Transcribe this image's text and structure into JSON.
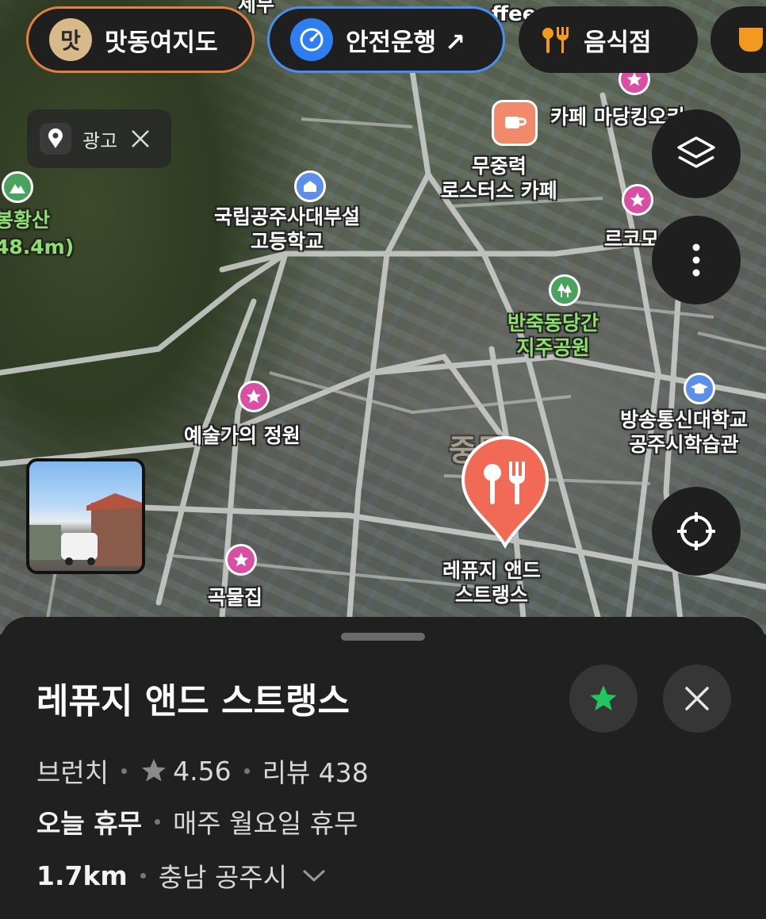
{
  "chips": {
    "matdong": {
      "icon_text": "맛",
      "label": "맛동여지도"
    },
    "safe": {
      "label": "안전운행 ↗"
    },
    "food": {
      "label": "음식점"
    }
  },
  "ad": {
    "label": "광고"
  },
  "map_labels": {
    "top_cut": "세무",
    "coffee_cut": "ffee",
    "mountain_name": "봉황산",
    "mountain_height": "48.4m)",
    "school": "국립공주사대부설\n고등학교",
    "cafe_madang": "카페 마당킹오키",
    "roasters": "무중력\n로스터스 카페",
    "le_ko": "르코모",
    "park": "반죽동당간\n지주공원",
    "art_garden": "예술가의 정원",
    "univ": "방송통신대학교\n공주시학습관",
    "district": "중동",
    "grain": "곡물집",
    "selected": "레퓨지 앤드\n스트랭스"
  },
  "place": {
    "name": "레퓨지 앤드 스트랭스",
    "category": "브런치",
    "rating": "4.56",
    "reviews": "리뷰 438",
    "status": "오늘 휴무",
    "hours_note": "매주 월요일 휴무",
    "distance": "1.7km",
    "region": "충남 공주시"
  },
  "colors": {
    "chip_matdong_border": "#e2813c",
    "chip_safe_border": "#4a8ff0",
    "food_accent": "#f39a1e",
    "marker": "#f06a55",
    "favorite_star": "#22c55e",
    "sheet_bg": "#202020"
  },
  "icons": [
    "map-marker-icon",
    "close-icon",
    "layers-icon",
    "more-vertical-icon",
    "locate-icon",
    "star-icon",
    "chevron-down-icon",
    "fork-knife-icon",
    "speedometer-icon"
  ]
}
